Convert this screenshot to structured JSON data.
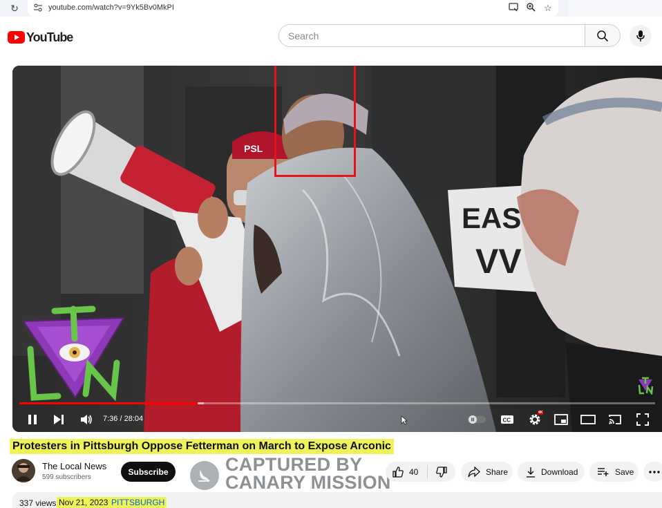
{
  "browser": {
    "url": "youtube.com/watch?v=9Yk5Bv0MkPI"
  },
  "header": {
    "logo_text": "YouTube",
    "search_placeholder": "Search"
  },
  "player": {
    "time_current": "7:36",
    "time_total": "28:04",
    "time_display": "7:36 / 28:04",
    "progress_played_fraction": 0.28,
    "progress_loaded_fraction": 0.29,
    "settings_badge": "4K",
    "overlay_logo_letters": "TLN"
  },
  "video": {
    "title": "Protesters in Pittsburgh Oppose Fetterman on March to Expose Arconic",
    "views": "337 views",
    "date": "Nov 21, 2023",
    "tag": "PITTSBURGH"
  },
  "channel": {
    "name": "The Local News",
    "subscribers": "599 subscribers",
    "subscribe_label": "Subscribe"
  },
  "watermark": {
    "line1": "CAPTURED BY",
    "line2": "CANARY MISSION"
  },
  "actions": {
    "like_count": "40",
    "share_label": "Share",
    "download_label": "Download",
    "save_label": "Save"
  },
  "colors": {
    "accent_red": "#ff0000",
    "highlight": "#eef35a",
    "face_box": "#e3141b"
  }
}
